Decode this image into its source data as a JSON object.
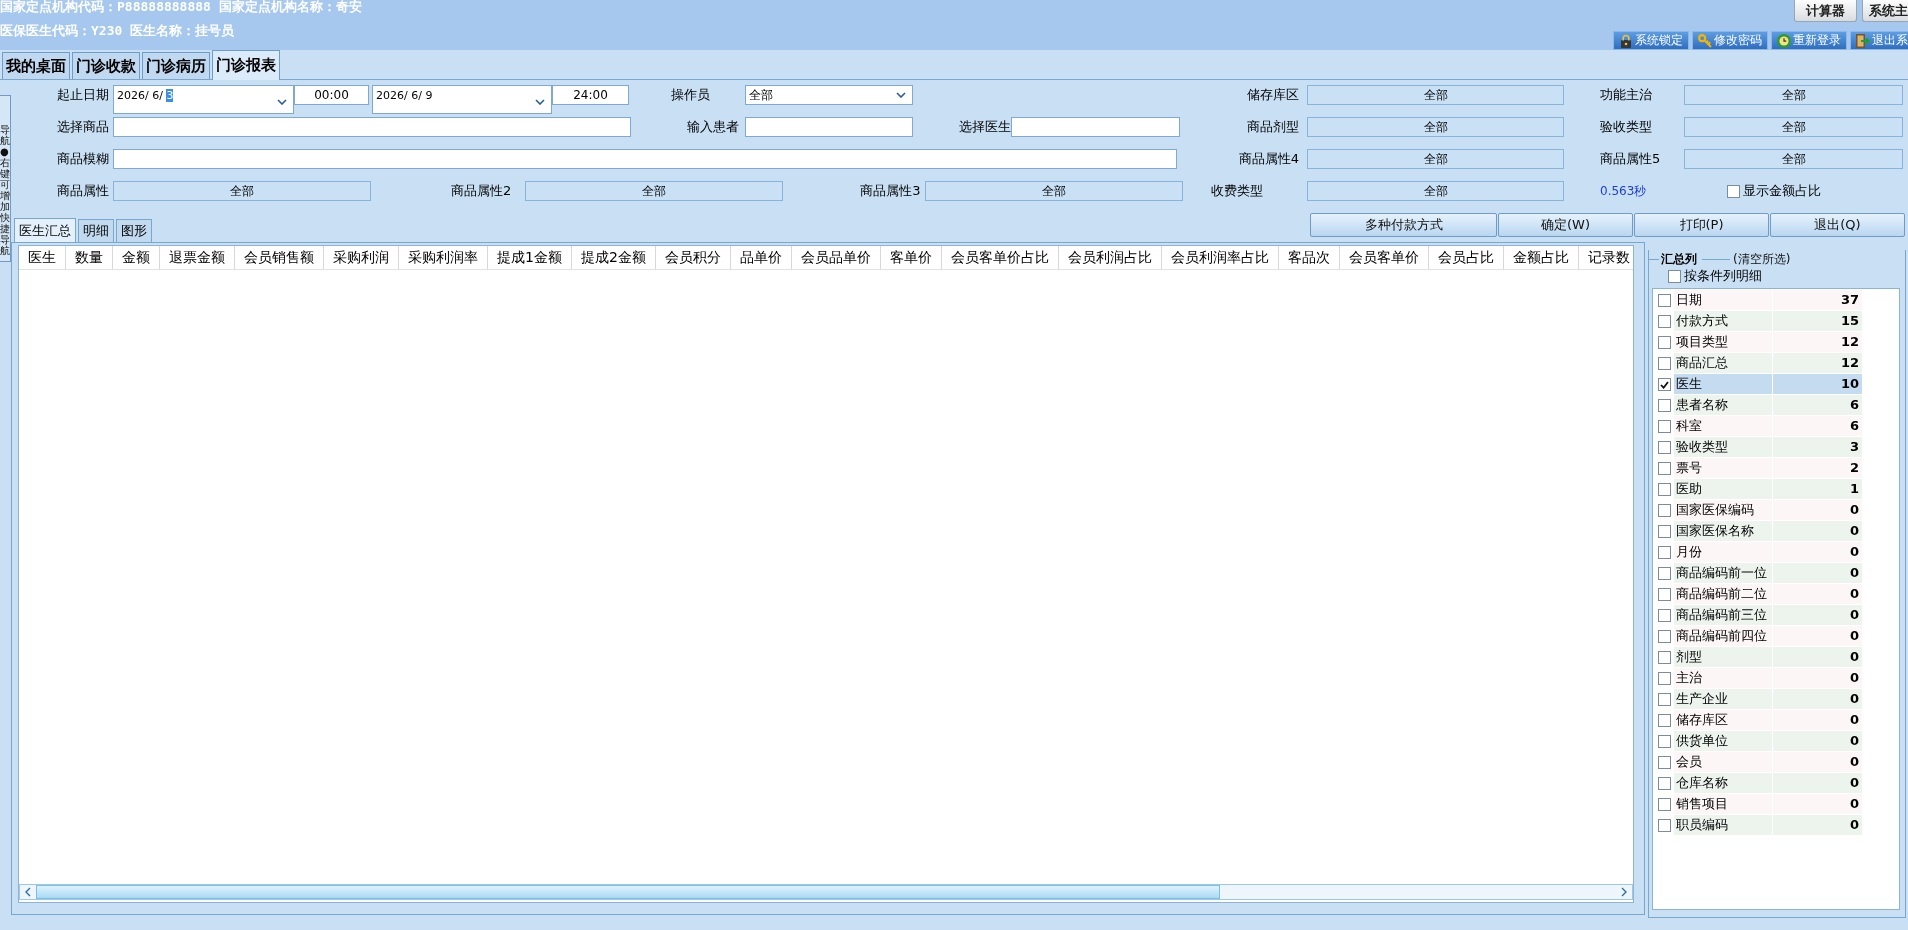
{
  "header": {
    "info_lines": [
      "国家定点机构代码：P88888888888 国家定点机构名称：奇安",
      "医保医生代码：Y230 医生名称：挂号员"
    ],
    "utility_buttons": [
      "计算器",
      "系统主"
    ],
    "account_buttons": [
      "系统锁定",
      "修改密码",
      "重新登录",
      "退出系"
    ]
  },
  "tabs": [
    {
      "label": "我的桌面",
      "selected": false
    },
    {
      "label": "门诊收款",
      "selected": false
    },
    {
      "label": "门诊病历",
      "selected": false
    },
    {
      "label": "门诊报表",
      "selected": true
    }
  ],
  "side_strip": {
    "text": "导航●右键可增加快捷导航"
  },
  "filter_rows": [
    {
      "left": [
        {
          "kind": "label",
          "text": "起止日期"
        },
        {
          "kind": "date",
          "value": "2026/ 6/ ",
          "selection": "3"
        },
        {
          "kind": "time",
          "value": "00:00"
        },
        {
          "kind": "date",
          "value": "2026/ 6/ 9"
        },
        {
          "kind": "time",
          "value": "24:00"
        },
        {
          "kind": "label",
          "text": "操作员"
        },
        {
          "kind": "combo",
          "value": "全部"
        }
      ],
      "right": [
        {
          "kind": "label",
          "text": "储存库区"
        },
        {
          "kind": "picker",
          "value": "全部"
        },
        {
          "kind": "label",
          "text": "功能主治"
        },
        {
          "kind": "picker",
          "value": "全部"
        }
      ]
    },
    {
      "left": [
        {
          "kind": "label",
          "text": "选择商品"
        },
        {
          "kind": "input"
        },
        {
          "kind": "label",
          "text": "输入患者"
        },
        {
          "kind": "input"
        },
        {
          "kind": "label",
          "text": "选择医生"
        },
        {
          "kind": "input"
        }
      ],
      "right": [
        {
          "kind": "label",
          "text": "商品剂型"
        },
        {
          "kind": "picker",
          "value": "全部"
        },
        {
          "kind": "label",
          "text": "验收类型"
        },
        {
          "kind": "picker",
          "value": "全部"
        }
      ]
    },
    {
      "left": [
        {
          "kind": "label",
          "text": "商品模糊"
        },
        {
          "kind": "input"
        }
      ],
      "right": [
        {
          "kind": "label",
          "text": "商品属性4"
        },
        {
          "kind": "picker",
          "value": "全部"
        },
        {
          "kind": "label",
          "text": "商品属性5"
        },
        {
          "kind": "picker",
          "value": "全部"
        }
      ]
    },
    {
      "left": [
        {
          "kind": "label",
          "text": "商品属性"
        },
        {
          "kind": "picker",
          "value": "全部"
        },
        {
          "kind": "label",
          "text": "商品属性2"
        },
        {
          "kind": "picker",
          "value": "全部"
        },
        {
          "kind": "label",
          "text": "商品属性3"
        },
        {
          "kind": "picker",
          "value": "全部"
        }
      ],
      "right": [
        {
          "kind": "label",
          "text": "收费类型"
        },
        {
          "kind": "picker",
          "value": "全部"
        },
        {
          "kind": "timing",
          "text": "0.563秒"
        },
        {
          "kind": "checkbox",
          "label": "显示金额占比",
          "checked": false
        }
      ]
    }
  ],
  "subtabs": [
    {
      "label": "医生汇总",
      "selected": true
    },
    {
      "label": "明细",
      "selected": false
    },
    {
      "label": "图形",
      "selected": false
    }
  ],
  "buttons": [
    "多种付款方式",
    "确定(W)",
    "打印(P)",
    "退出(Q)"
  ],
  "table": {
    "columns": [
      "医生",
      "数量",
      "金额",
      "退票金额",
      "会员销售额",
      "采购利润",
      "采购利润率",
      "提成1金额",
      "提成2金额",
      "会员积分",
      "品单价",
      "会员品单价",
      "客单价",
      "会员客单价占比",
      "会员利润占比",
      "会员利润率占比",
      "客品次",
      "会员客单价",
      "会员占比",
      "金额占比",
      "记录数"
    ]
  },
  "summary_panel": {
    "title": "汇总列",
    "clear_link": "(清空所选)",
    "detail_option": {
      "label": "按条件列明细",
      "checked": false
    },
    "items": [
      {
        "label": "日期",
        "count": "37",
        "checked": false,
        "selected": false
      },
      {
        "label": "付款方式",
        "count": "15",
        "checked": false,
        "selected": false
      },
      {
        "label": "项目类型",
        "count": "12",
        "checked": false,
        "selected": false
      },
      {
        "label": "商品汇总",
        "count": "12",
        "checked": false,
        "selected": false
      },
      {
        "label": "医生",
        "count": "10",
        "checked": true,
        "selected": true
      },
      {
        "label": "患者名称",
        "count": "6",
        "checked": false,
        "selected": false
      },
      {
        "label": "科室",
        "count": "6",
        "checked": false,
        "selected": false
      },
      {
        "label": "验收类型",
        "count": "3",
        "checked": false,
        "selected": false
      },
      {
        "label": "票号",
        "count": "2",
        "checked": false,
        "selected": false
      },
      {
        "label": "医助",
        "count": "1",
        "checked": false,
        "selected": false
      },
      {
        "label": "国家医保编码",
        "count": "0",
        "checked": false,
        "selected": false
      },
      {
        "label": "国家医保名称",
        "count": "0",
        "checked": false,
        "selected": false
      },
      {
        "label": "月份",
        "count": "0",
        "checked": false,
        "selected": false
      },
      {
        "label": "商品编码前一位",
        "count": "0",
        "checked": false,
        "selected": false
      },
      {
        "label": "商品编码前二位",
        "count": "0",
        "checked": false,
        "selected": false
      },
      {
        "label": "商品编码前三位",
        "count": "0",
        "checked": false,
        "selected": false
      },
      {
        "label": "商品编码前四位",
        "count": "0",
        "checked": false,
        "selected": false
      },
      {
        "label": "剂型",
        "count": "0",
        "checked": false,
        "selected": false
      },
      {
        "label": "主治",
        "count": "0",
        "checked": false,
        "selected": false
      },
      {
        "label": "生产企业",
        "count": "0",
        "checked": false,
        "selected": false
      },
      {
        "label": "储存库区",
        "count": "0",
        "checked": false,
        "selected": false
      },
      {
        "label": "供货单位",
        "count": "0",
        "checked": false,
        "selected": false
      },
      {
        "label": "会员",
        "count": "0",
        "checked": false,
        "selected": false
      },
      {
        "label": "仓库名称",
        "count": "0",
        "checked": false,
        "selected": false
      },
      {
        "label": "销售项目",
        "count": "0",
        "checked": false,
        "selected": false
      },
      {
        "label": "职员编码",
        "count": "0",
        "checked": false,
        "selected": false
      }
    ]
  }
}
